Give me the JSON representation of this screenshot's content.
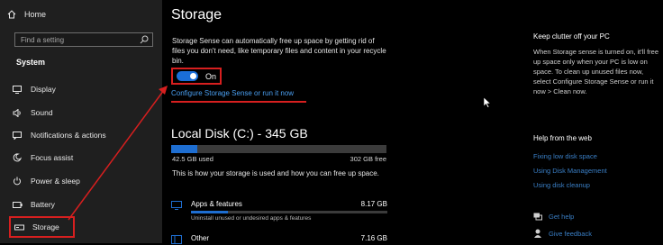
{
  "sidebar": {
    "home_label": "Home",
    "search_placeholder": "Find a setting",
    "section_label": "System",
    "items": [
      {
        "label": "Display",
        "icon": "monitor-icon"
      },
      {
        "label": "Sound",
        "icon": "speaker-icon"
      },
      {
        "label": "Notifications & actions",
        "icon": "notification-icon"
      },
      {
        "label": "Focus assist",
        "icon": "moon-icon"
      },
      {
        "label": "Power & sleep",
        "icon": "power-icon"
      },
      {
        "label": "Battery",
        "icon": "battery-icon"
      },
      {
        "label": "Storage",
        "icon": "storage-icon"
      }
    ]
  },
  "main": {
    "title": "Storage",
    "intro": "Storage Sense can automatically free up space by getting rid of files you don't need, like temporary files and content in your recycle bin.",
    "toggle": {
      "state_label": "On",
      "on": true
    },
    "configure_link": "Configure Storage Sense or run it now",
    "disk": {
      "title": "Local Disk (C:) - 345 GB",
      "used_label": "42.5 GB used",
      "free_label": "302 GB free",
      "used_fraction": 0.123,
      "description": "This is how your storage is used and how you can free up space."
    },
    "categories": [
      {
        "name": "Apps & features",
        "size": "8.17 GB",
        "sub": "Uninstall unused or undesired apps & features",
        "fraction": 0.19
      },
      {
        "name": "Other",
        "size": "7.16 GB",
        "sub": "",
        "fraction": 0.17
      }
    ]
  },
  "right": {
    "clutter_heading": "Keep clutter off your PC",
    "clutter_text": "When Storage sense is turned on, it'll free up space only when your PC is low on space. To clean up unused files now, select Configure Storage Sense or run it now > Clean now.",
    "help_heading": "Help from the web",
    "help_links": [
      "Fixing low disk space",
      "Using Disk Management",
      "Using disk cleanup"
    ],
    "get_help": "Get help",
    "give_feedback": "Give feedback"
  },
  "colors": {
    "accent": "#1e6ed1",
    "link": "#4a9ef0",
    "annotation": "#d71f1f"
  }
}
